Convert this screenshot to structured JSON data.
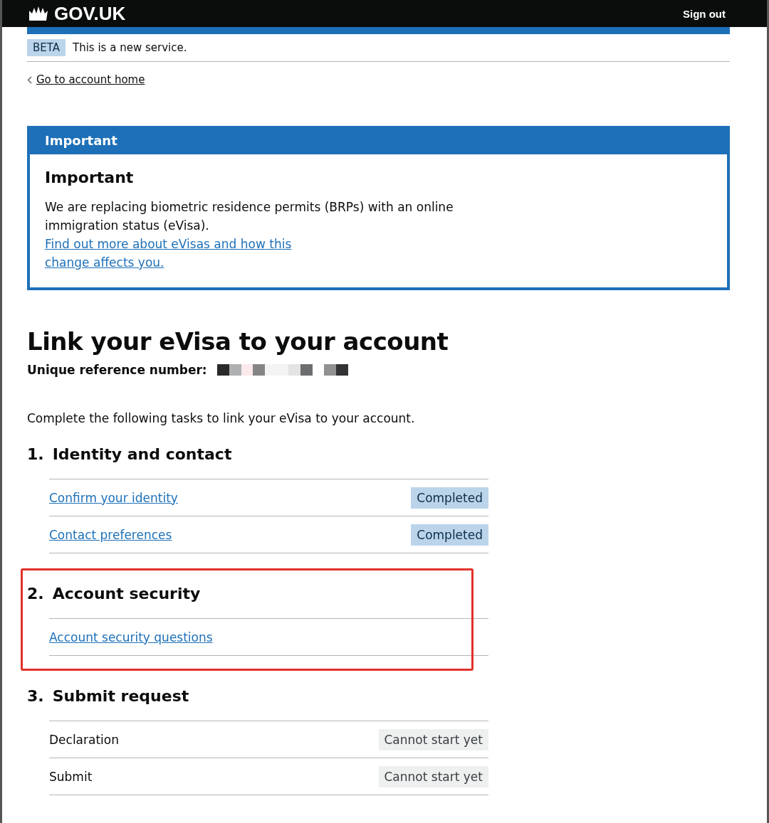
{
  "header": {
    "logo": "GOV.UK",
    "sign_out": "Sign out"
  },
  "phase_banner": {
    "tag": "BETA",
    "text": "This is a new service."
  },
  "back_link": "Go to account home",
  "notification": {
    "title": "Important",
    "heading": "Important",
    "text": "We are replacing biometric residence permits (BRPs) with an online immigration status (eVisa). ",
    "link_lines": [
      "Find out more about eVisas and how this",
      "change affects you."
    ]
  },
  "page_title": "Link your eVisa to your account",
  "reference": {
    "label": "Unique reference number:"
  },
  "intro": "Complete the following tasks to link your eVisa to your account.",
  "sections": [
    {
      "number": "1.",
      "title": "Identity and contact",
      "highlighted": false,
      "tasks": [
        {
          "name": "Confirm your identity",
          "linked": true,
          "status": {
            "kind": "completed",
            "text": "Completed"
          }
        },
        {
          "name": "Contact preferences",
          "linked": true,
          "status": {
            "kind": "completed",
            "text": "Completed"
          }
        }
      ]
    },
    {
      "number": "2.",
      "title": "Account security",
      "highlighted": true,
      "tasks": [
        {
          "name": "Account security questions",
          "linked": true
        }
      ]
    },
    {
      "number": "3.",
      "title": "Submit request",
      "highlighted": false,
      "tasks": [
        {
          "name": "Declaration",
          "linked": false,
          "status": {
            "kind": "cannot_start",
            "text": "Cannot start yet"
          }
        },
        {
          "name": "Submit",
          "linked": false,
          "status": {
            "kind": "cannot_start",
            "text": "Cannot start yet"
          }
        }
      ]
    }
  ]
}
